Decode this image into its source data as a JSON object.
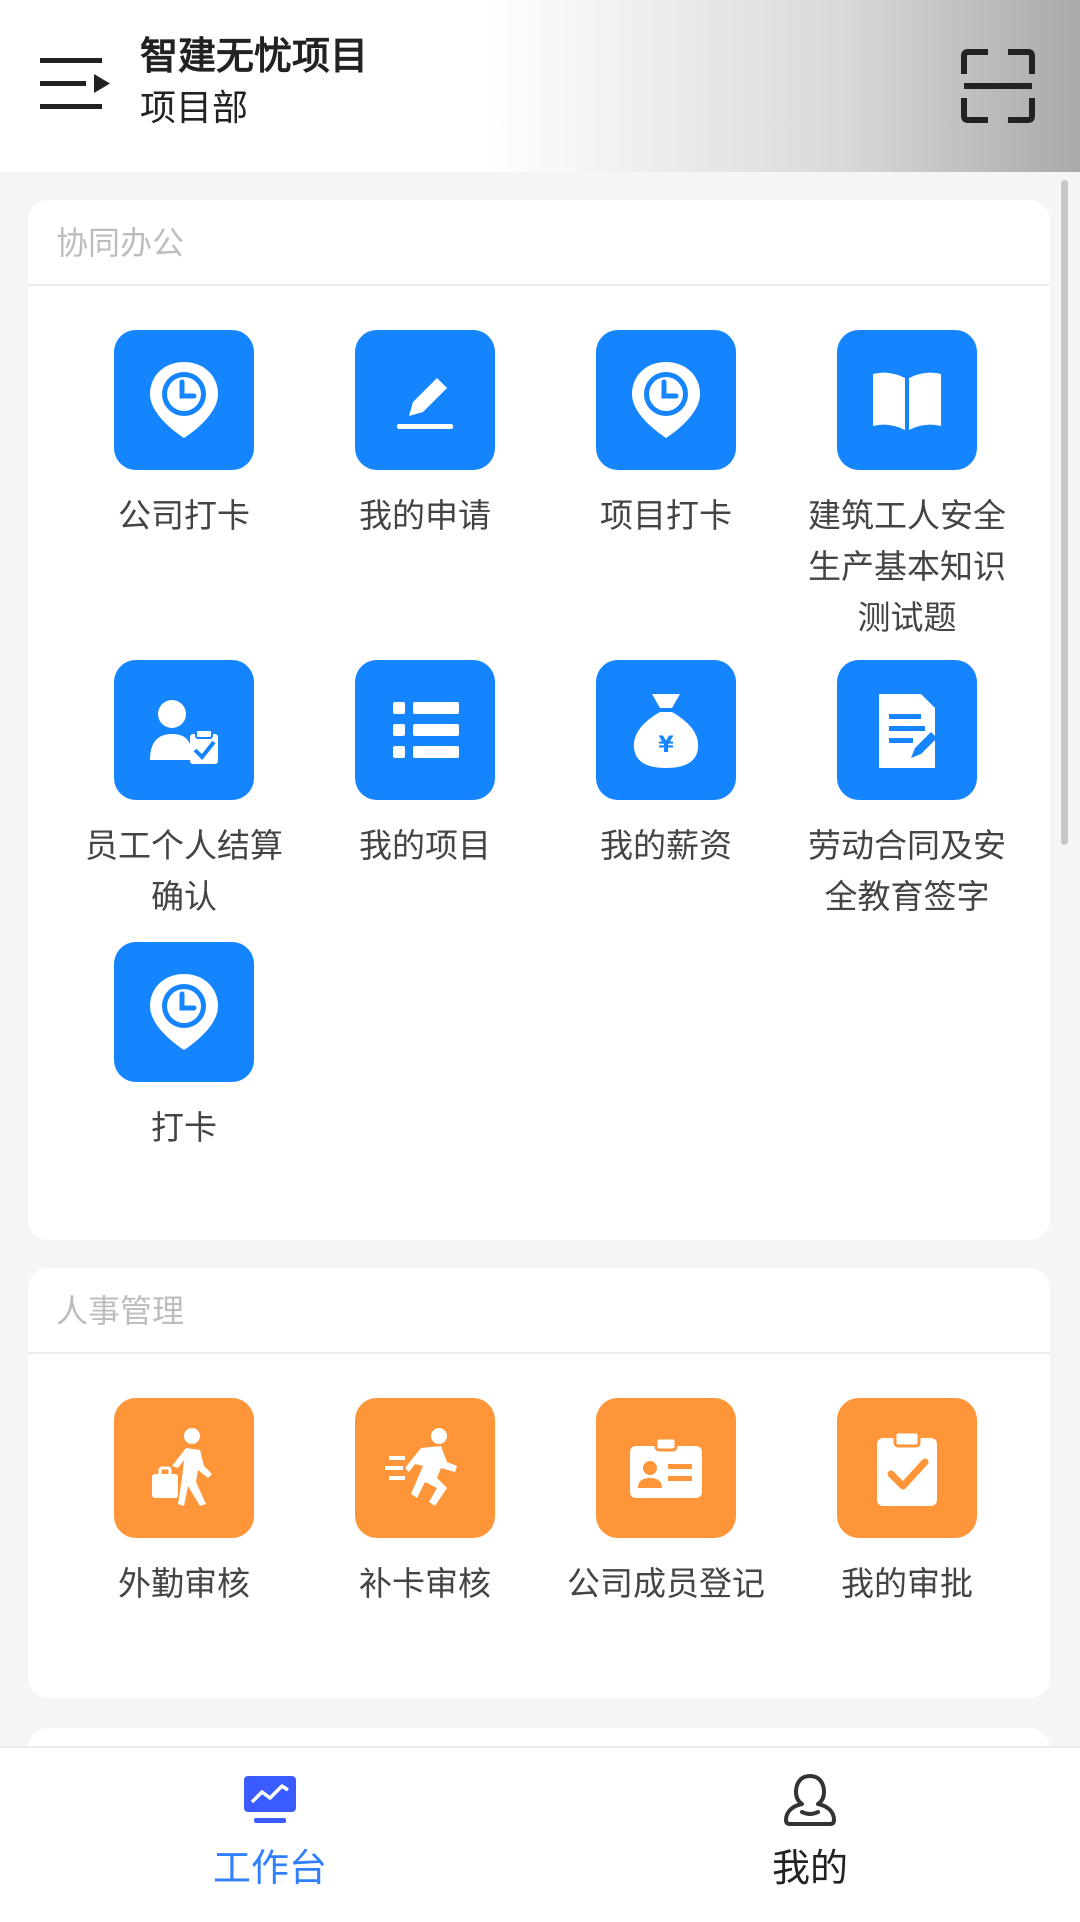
{
  "header": {
    "title": "智建无忧项目",
    "subtitle": "项目部"
  },
  "sections": [
    {
      "title": "协同办公",
      "accent": "#1585ff",
      "items": [
        {
          "label": "公司打卡",
          "icon": "clock-pin-icon"
        },
        {
          "label": "我的申请",
          "icon": "pencil-icon"
        },
        {
          "label": "项目打卡",
          "icon": "clock-pin-icon"
        },
        {
          "label": "建筑工人安全生产基本知识测试题",
          "icon": "book-icon"
        },
        {
          "label": "员工个人结算确认",
          "icon": "person-clipboard-icon"
        },
        {
          "label": "我的项目",
          "icon": "list-icon"
        },
        {
          "label": "我的薪资",
          "icon": "money-bag-icon"
        },
        {
          "label": "劳动合同及安全教育签字",
          "icon": "document-sign-icon"
        },
        {
          "label": "打卡",
          "icon": "clock-pin-icon"
        }
      ]
    },
    {
      "title": "人事管理",
      "accent": "#fe9639",
      "items": [
        {
          "label": "外勤审核",
          "icon": "walking-briefcase-icon"
        },
        {
          "label": "补卡审核",
          "icon": "running-icon"
        },
        {
          "label": "公司成员登记",
          "icon": "id-card-icon"
        },
        {
          "label": "我的审批",
          "icon": "clipboard-check-icon"
        }
      ]
    }
  ],
  "tabbar": {
    "active_color": "#2f7fff",
    "items": [
      {
        "label": "工作台",
        "icon": "monitor-chart-icon",
        "active": true
      },
      {
        "label": "我的",
        "icon": "user-icon",
        "active": false
      }
    ]
  }
}
